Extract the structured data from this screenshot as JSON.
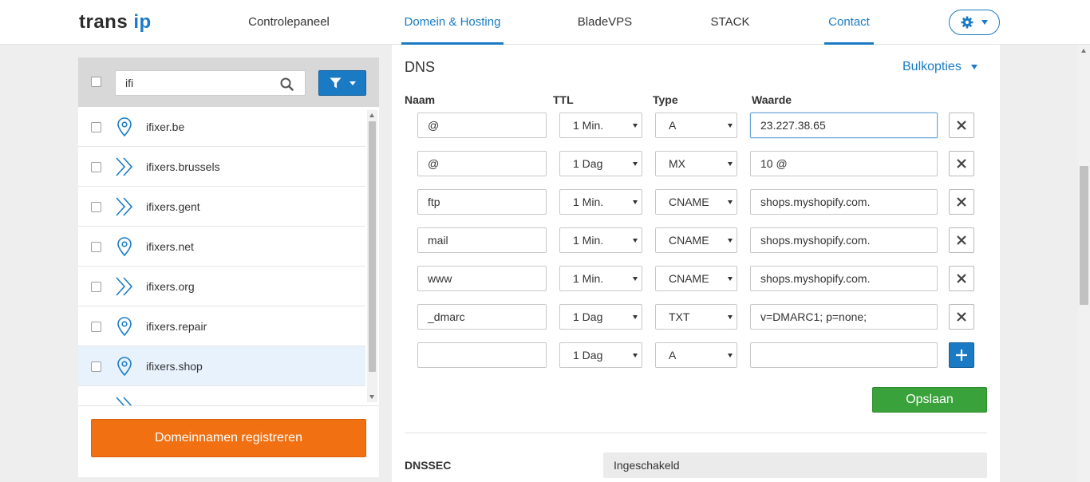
{
  "brand": {
    "logo_left": "trans",
    "logo_right": "ip"
  },
  "nav": {
    "items": [
      {
        "label": "Controlepaneel",
        "active": false
      },
      {
        "label": "Domein & Hosting",
        "active": true
      },
      {
        "label": "BladeVPS",
        "active": false
      },
      {
        "label": "STACK",
        "active": false
      },
      {
        "label": "Contact",
        "active": true
      }
    ],
    "settings_icon": "gear-icon"
  },
  "sidebar": {
    "search": {
      "value": "ifi",
      "placeholder": ""
    },
    "domains": [
      {
        "name": "ifixer.be",
        "icon": "location-pin-icon",
        "selected": false
      },
      {
        "name": "ifixers.brussels",
        "icon": "forward-chevrons-icon",
        "selected": false
      },
      {
        "name": "ifixers.gent",
        "icon": "forward-chevrons-icon",
        "selected": false
      },
      {
        "name": "ifixers.net",
        "icon": "location-pin-icon",
        "selected": false
      },
      {
        "name": "ifixers.org",
        "icon": "forward-chevrons-icon",
        "selected": false
      },
      {
        "name": "ifixers.repair",
        "icon": "location-pin-icon",
        "selected": false
      },
      {
        "name": "ifixers.shop",
        "icon": "location-pin-icon",
        "selected": true
      },
      {
        "name": "",
        "icon": "forward-chevrons-icon",
        "selected": false
      }
    ],
    "register_label": "Domeinnamen registreren"
  },
  "dns": {
    "title": "DNS",
    "bulk_label": "Bulkopties",
    "columns": {
      "name": "Naam",
      "ttl": "TTL",
      "type": "Type",
      "value": "Waarde"
    },
    "records": [
      {
        "name": "@",
        "ttl": "1 Min.",
        "type": "A",
        "value": "23.227.38.65"
      },
      {
        "name": "@",
        "ttl": "1 Dag",
        "type": "MX",
        "value": "10 @"
      },
      {
        "name": "ftp",
        "ttl": "1 Min.",
        "type": "CNAME",
        "value": "shops.myshopify.com."
      },
      {
        "name": "mail",
        "ttl": "1 Min.",
        "type": "CNAME",
        "value": "shops.myshopify.com."
      },
      {
        "name": "www",
        "ttl": "1 Min.",
        "type": "CNAME",
        "value": "shops.myshopify.com."
      },
      {
        "name": "_dmarc",
        "ttl": "1 Dag",
        "type": "TXT",
        "value": "v=DMARC1; p=none;"
      }
    ],
    "new_record": {
      "name": "",
      "ttl": "1 Dag",
      "type": "A",
      "value": ""
    },
    "save_label": "Opslaan",
    "dnssec_label": "DNSSEC",
    "dnssec_value": "Ingeschakeld"
  },
  "colors": {
    "accent": "#1a7bc4",
    "register": "#f07012",
    "save": "#3aa23a",
    "selected_row": "#e8f2fc"
  }
}
